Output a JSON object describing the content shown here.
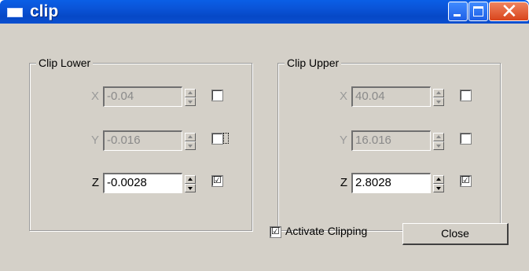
{
  "window": {
    "title": "clip"
  },
  "lower": {
    "title": "Clip Lower",
    "rows": [
      {
        "axis": "X",
        "value": "-0.04",
        "checked": false,
        "enabled": false
      },
      {
        "axis": "Y",
        "value": "-0.016",
        "checked": false,
        "enabled": false
      },
      {
        "axis": "Z",
        "value": "-0.0028",
        "checked": true,
        "enabled": true
      }
    ]
  },
  "upper": {
    "title": "Clip Upper",
    "rows": [
      {
        "axis": "X",
        "value": "40.04",
        "checked": false,
        "enabled": false
      },
      {
        "axis": "Y",
        "value": "16.016",
        "checked": false,
        "enabled": false
      },
      {
        "axis": "Z",
        "value": "2.8028",
        "checked": true,
        "enabled": true
      }
    ]
  },
  "activate": {
    "label": "Activate Clipping",
    "checked": true
  },
  "close_button": {
    "label": "Close"
  },
  "colors": {
    "titlebar": "#0a54d8",
    "panel": "#d4d0c8",
    "close_button": "#d9441c"
  },
  "check_glyph": "☑"
}
